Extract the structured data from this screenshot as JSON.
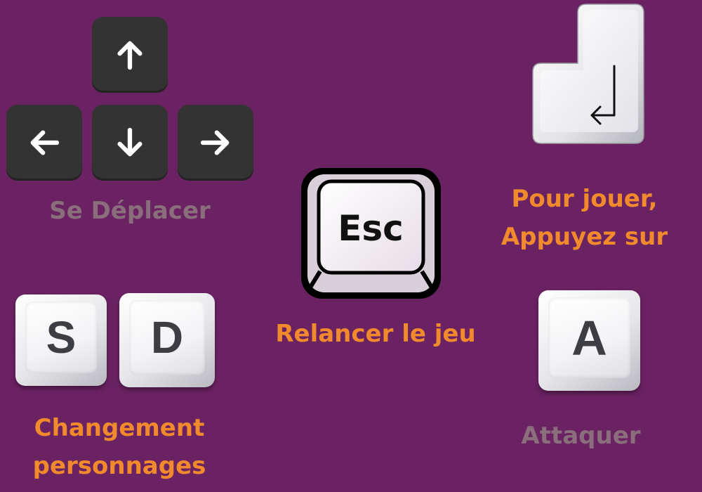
{
  "colors": {
    "background": "#6b2262",
    "accent": "#f08a2c",
    "muted": "#8a6e7c"
  },
  "controls": {
    "move": {
      "icons": [
        "arrow-up",
        "arrow-left",
        "arrow-down",
        "arrow-right"
      ],
      "label": "Se Déplacer"
    },
    "play": {
      "icon": "enter-key",
      "line1": "Pour jouer,",
      "line2": "Appuyez sur"
    },
    "restart": {
      "key": "Esc",
      "label": "Relancer le jeu"
    },
    "switch": {
      "keys": [
        "S",
        "D"
      ],
      "line1": "Changement",
      "line2": "personnages"
    },
    "attack": {
      "key": "A",
      "label": "Attaquer"
    }
  }
}
